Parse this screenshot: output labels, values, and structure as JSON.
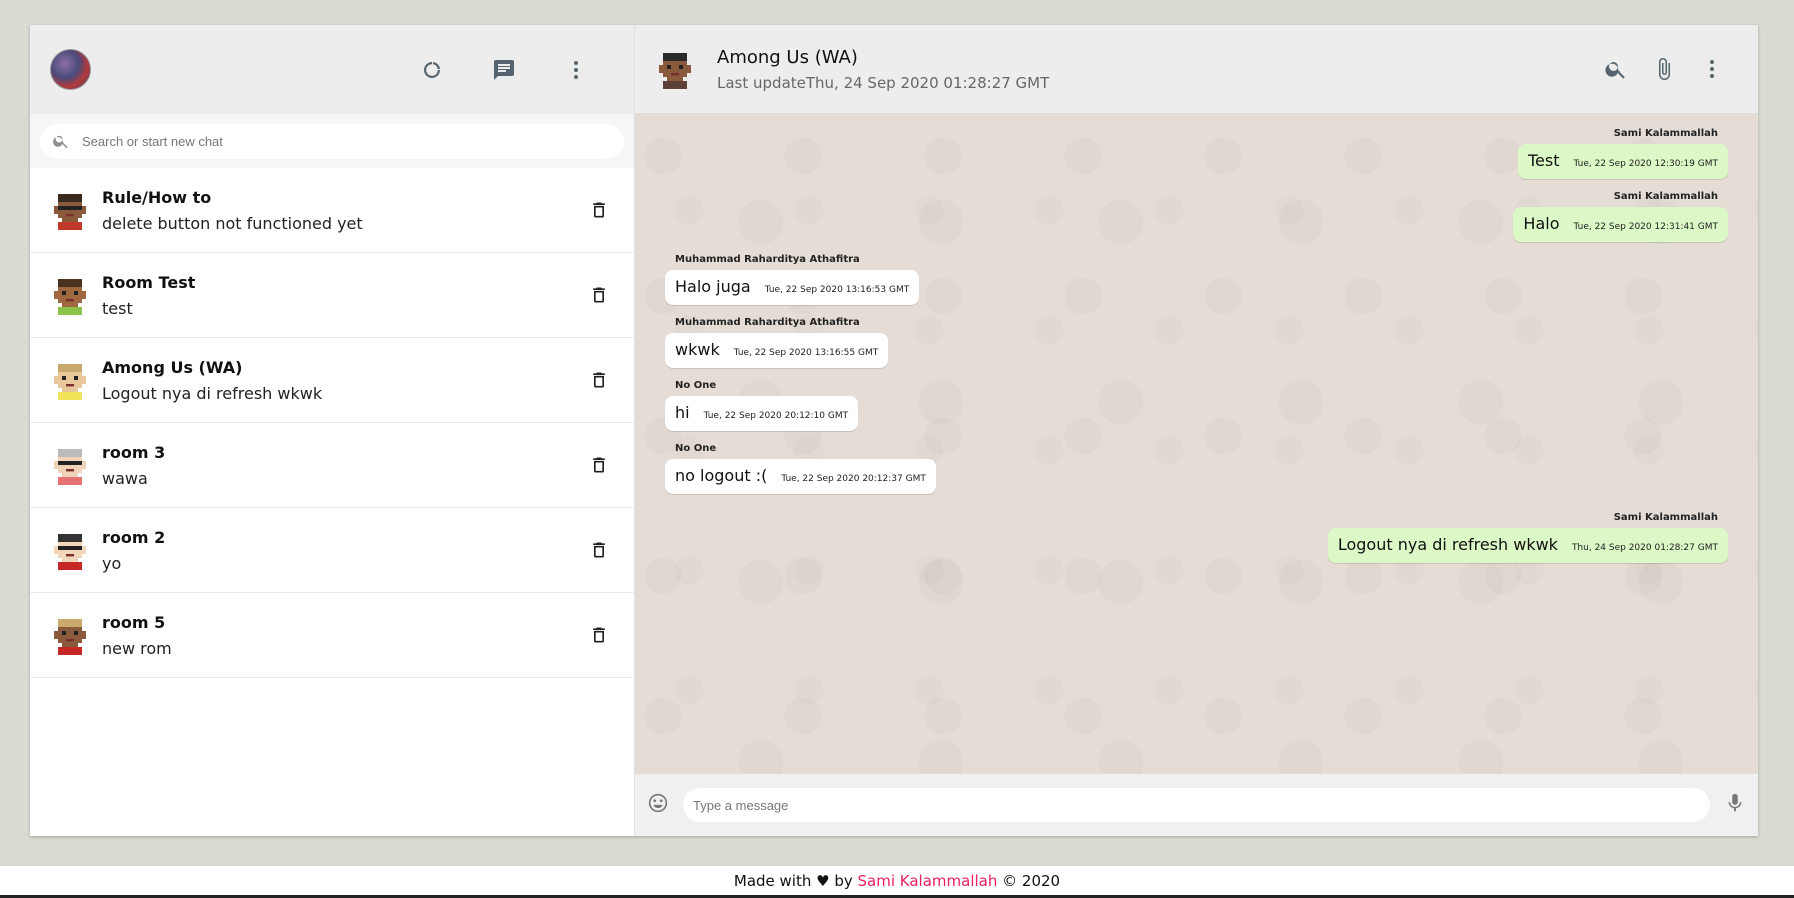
{
  "sidebar": {
    "search_placeholder": "Search or start new chat",
    "header_icons": [
      "refresh-icon",
      "chat-icon",
      "more-vert-icon"
    ],
    "rooms": [
      {
        "name": "Rule/How to",
        "last": "delete button not functioned yet",
        "avatar": {
          "skin": "#8a5a3c",
          "hair": "#3a2a1e",
          "shirt": "#c0392b",
          "glasses": true
        }
      },
      {
        "name": "Room Test",
        "last": "test",
        "avatar": {
          "skin": "#a0683e",
          "hair": "#4a3220",
          "shirt": "#8bc34a",
          "glasses": false
        }
      },
      {
        "name": "Among Us (WA)",
        "last": "Logout nya di refresh wkwk",
        "avatar": {
          "skin": "#e8c89a",
          "hair": "#c9a96e",
          "shirt": "#f1e45a",
          "glasses": false
        }
      },
      {
        "name": "room 3",
        "last": "wawa",
        "avatar": {
          "skin": "#f0d3b8",
          "hair": "#bbbbbb",
          "shirt": "#e57373",
          "glasses": true
        }
      },
      {
        "name": "room 2",
        "last": "yo",
        "avatar": {
          "skin": "#f2d6bc",
          "hair": "#333333",
          "shirt": "#c62828",
          "glasses": true
        }
      },
      {
        "name": "room 5",
        "last": "new rom",
        "avatar": {
          "skin": "#8a5a3c",
          "hair": "#c9a96e",
          "shirt": "#c62828",
          "glasses": false
        }
      }
    ]
  },
  "chat": {
    "title": "Among Us (WA)",
    "subtitle": "Last updateThu, 24 Sep 2020 01:28:27 GMT",
    "avatar": {
      "skin": "#8a5a3c",
      "hair": "#2a2a2a",
      "shirt": "#5d4037",
      "glasses": false
    },
    "header_icons": [
      "search-icon",
      "attach-icon",
      "more-vert-icon"
    ],
    "messages": [
      {
        "sender": "Sami Kalammallah",
        "text": "Test",
        "time": "Tue, 22 Sep 2020 12:30:19 GMT",
        "dir": "out"
      },
      {
        "sender": "Sami Kalammallah",
        "text": "Halo",
        "time": "Tue, 22 Sep 2020 12:31:41 GMT",
        "dir": "out"
      },
      {
        "sender": "Muhammad Raharditya Athafitra",
        "text": "Halo juga",
        "time": "Tue, 22 Sep 2020 13:16:53 GMT",
        "dir": "in"
      },
      {
        "sender": "Muhammad Raharditya Athafitra",
        "text": "wkwk",
        "time": "Tue, 22 Sep 2020 13:16:55 GMT",
        "dir": "in"
      },
      {
        "sender": "No One",
        "text": "hi",
        "time": "Tue, 22 Sep 2020 20:12:10 GMT",
        "dir": "in"
      },
      {
        "sender": "No One",
        "text": "no logout :(",
        "time": "Tue, 22 Sep 2020 20:12:37 GMT",
        "dir": "in"
      },
      {
        "sender": "Sami Kalammallah",
        "text": "Logout nya di refresh wkwk",
        "time": "Thu, 24 Sep 2020 01:28:27 GMT",
        "dir": "out"
      }
    ],
    "composer_placeholder": "Type a message"
  },
  "footer": {
    "prefix": "Made with ♥ by",
    "author": "Sami Kalammallah",
    "suffix": "© 2020"
  },
  "colors": {
    "outgoing_bubble": "#dcf8c6",
    "incoming_bubble": "#ffffff",
    "chat_bg": "#e5ddd5",
    "header_bg": "#ededed",
    "footer_author": "#e91e63"
  }
}
